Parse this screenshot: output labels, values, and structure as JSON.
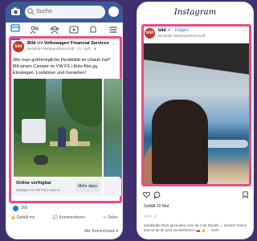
{
  "facebook": {
    "search_placeholder": "Suche",
    "post": {
      "avatar_text": "bild",
      "author": "Bild",
      "with_text": "mit",
      "partner": "Volkswagen Financial Services",
      "subtitle": "Bezahlte Werbepartnerschaft · 21. April · ⊕",
      "text": "Wie man größtmögliche Flexibilität im Urlaub hat? Mit einem Camper im VW FS | Auto Abo 🚌 Einsteigen, Losfahren und Genießen!",
      "cta_title": "Online verfügbar",
      "cta_subtitle": "Camper im VW FS | Auto A...",
      "cta_button": "Mehr dazu",
      "like_count": "356",
      "actions": [
        "Gefällt mir",
        "Kommentieren",
        "Teilen"
      ],
      "all_comments": "Alle Kommentare ▾"
    }
  },
  "instagram": {
    "logo": "Instagram",
    "post": {
      "author": "bild",
      "follow_label": "Folgen",
      "subtitle": "Bezahlte Werbepartnerschaft",
      "likes": "Gefällt 10 Mal",
      "date": "APR. 17",
      "caption": "autobildde Dein gesundes Auto ab 1.64 Modell → Diesen Traum kannst du dir jetzt verwirklichen! 🚗 👍 ... mehr"
    }
  },
  "colors": {
    "facebook_blue": "#3b5998",
    "highlight": "#ea4c89",
    "background": "#3f2f6e"
  }
}
